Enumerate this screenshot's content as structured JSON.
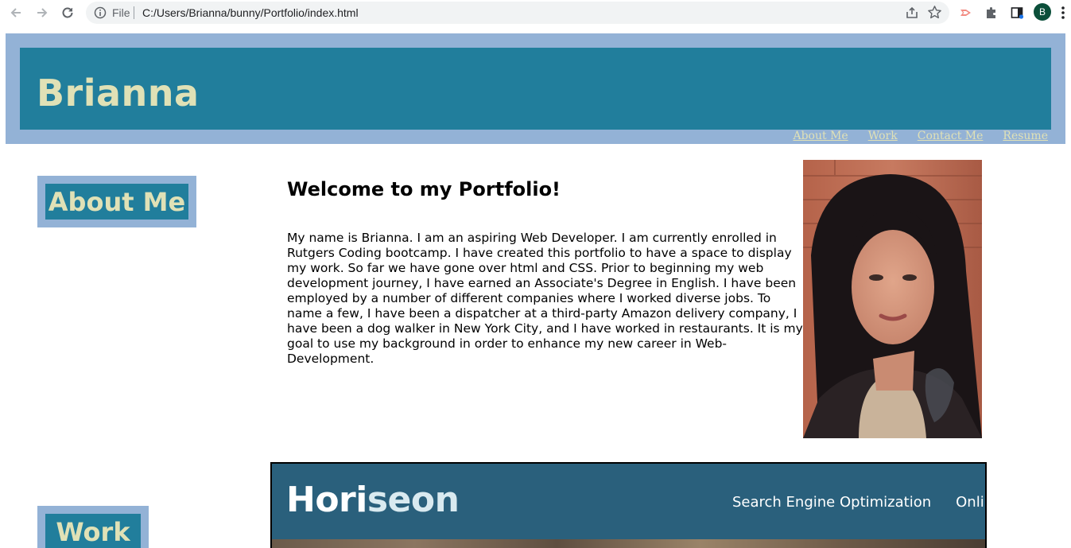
{
  "browser": {
    "file_label": "File",
    "url": "C:/Users/Brianna/bunny/Portfolio/index.html",
    "profile_initial": "B",
    "icons": [
      "back-arrow-icon",
      "forward-arrow-icon",
      "reload-icon",
      "info-icon",
      "share-icon",
      "star-icon",
      "extension-icon",
      "puzzle-icon",
      "side-panel-icon",
      "menu-dots-icon"
    ]
  },
  "header": {
    "name": "Brianna",
    "nav": [
      "About Me",
      "Work",
      "Contact Me",
      "Resume"
    ]
  },
  "about": {
    "label": "About Me",
    "heading": "Welcome to my Portfolio!",
    "bio": "My name is Brianna. I am an aspiring Web Developer. I am currently enrolled in Rutgers Coding bootcamp. I have created this portfolio to have a space to display my work. So far we have gone over html and CSS. Prior to beginning my web development journey, I have earned an Associate's Degree in English. I have been employed by a number of different companies where I worked diverse jobs. To name a few, I have been a dispatcher at a third-party Amazon delivery company, I have been a dog walker in New York City, and I have worked in restaurants. It is my goal to use my background in order to enhance my new career in Web-Development."
  },
  "work": {
    "label": "Work",
    "project": {
      "logo_part1": "Hori",
      "logo_part2": "seon",
      "nav": [
        "Search Engine Optimization",
        "Online R"
      ]
    }
  },
  "colors": {
    "header_outer": "#93b2d6",
    "header_band": "#217e9c",
    "accent_text": "#e0e1b6",
    "project_header": "#2a607c"
  }
}
